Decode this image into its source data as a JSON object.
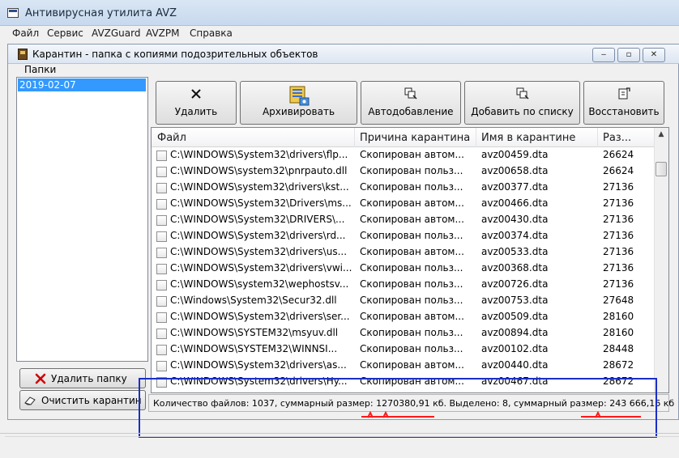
{
  "app": {
    "title": "Антивирусная утилита AVZ",
    "menu": [
      "Файл",
      "Сервис",
      "AVZGuard",
      "AVZPM",
      "Справка"
    ]
  },
  "quarantine": {
    "title": "Карантин - папка с копиями подозрительных объектов",
    "window_buttons": {
      "minimize": "‒",
      "restore": "▫",
      "close": "✕"
    },
    "folders": {
      "label": "Папки",
      "items": [
        "2019-02-07"
      ],
      "delete_button": "Удалить папку",
      "clear_button": "Очистить карантин"
    },
    "toolbar": {
      "delete": "Удалить",
      "archive": "Архивировать",
      "autoadd": "Автодобавление",
      "addlist": "Добавить по списку",
      "restore": "Восстановить"
    },
    "table": {
      "columns": [
        "Файл",
        "Причина карантина",
        "Имя в карантине",
        "Раз..."
      ],
      "rows": [
        {
          "file": "C:\\WINDOWS\\System32\\drivers\\flp...",
          "reason": "Скопирован автом...",
          "qname": "avz00459.dta",
          "size": "26624"
        },
        {
          "file": "C:\\WINDOWS\\system32\\pnrpauto.dll",
          "reason": "Скопирован польз...",
          "qname": "avz00658.dta",
          "size": "26624"
        },
        {
          "file": "C:\\WINDOWS\\system32\\drivers\\kst...",
          "reason": "Скопирован польз...",
          "qname": "avz00377.dta",
          "size": "27136"
        },
        {
          "file": "C:\\WINDOWS\\System32\\Drivers\\ms...",
          "reason": "Скопирован автом...",
          "qname": "avz00466.dta",
          "size": "27136"
        },
        {
          "file": "C:\\WINDOWS\\System32\\DRIVERS\\...",
          "reason": "Скопирован автом...",
          "qname": "avz00430.dta",
          "size": "27136"
        },
        {
          "file": "C:\\WINDOWS\\System32\\drivers\\rd...",
          "reason": "Скопирован польз...",
          "qname": "avz00374.dta",
          "size": "27136"
        },
        {
          "file": "C:\\WINDOWS\\System32\\drivers\\us...",
          "reason": "Скопирован автом...",
          "qname": "avz00533.dta",
          "size": "27136"
        },
        {
          "file": "C:\\WINDOWS\\System32\\drivers\\vwi...",
          "reason": "Скопирован польз...",
          "qname": "avz00368.dta",
          "size": "27136"
        },
        {
          "file": "C:\\WINDOWS\\system32\\wephostsv...",
          "reason": "Скопирован польз...",
          "qname": "avz00726.dta",
          "size": "27136"
        },
        {
          "file": "C:\\Windows\\System32\\Secur32.dll",
          "reason": "Скопирован польз...",
          "qname": "avz00753.dta",
          "size": "27648"
        },
        {
          "file": "C:\\WINDOWS\\System32\\drivers\\ser...",
          "reason": "Скопирован автом...",
          "qname": "avz00509.dta",
          "size": "28160"
        },
        {
          "file": "C:\\WINDOWS\\SYSTEM32\\msyuv.dll",
          "reason": "Скопирован польз...",
          "qname": "avz00894.dta",
          "size": "28160"
        },
        {
          "file": "C:\\WINDOWS\\SYSTEM32\\WINNSI...",
          "reason": "Скопирован польз...",
          "qname": "avz00102.dta",
          "size": "28448"
        },
        {
          "file": "C:\\WINDOWS\\System32\\drivers\\as...",
          "reason": "Скопирован автом...",
          "qname": "avz00440.dta",
          "size": "28672"
        },
        {
          "file": "C:\\WINDOWS\\System32\\drivers\\Hy...",
          "reason": "Скопирован автом...",
          "qname": "avz00467.dta",
          "size": "28672"
        }
      ]
    },
    "status": "Количество файлов: 1037, суммарный размер: 1270380,91 кб. Выделено:  8, суммарный размер: 243 666,16 кб"
  },
  "colors": {
    "selection": "#3399ff",
    "highlight_box": "#1a2ec8",
    "underline": "#ff1a1a"
  },
  "icons": {
    "delete": "close-x-icon",
    "archive": "archive-zip-icon",
    "autoadd": "auto-add-icon",
    "addlist": "add-list-icon",
    "restore": "restore-icon",
    "delete_folder": "red-x-icon",
    "clear": "eraser-icon"
  }
}
